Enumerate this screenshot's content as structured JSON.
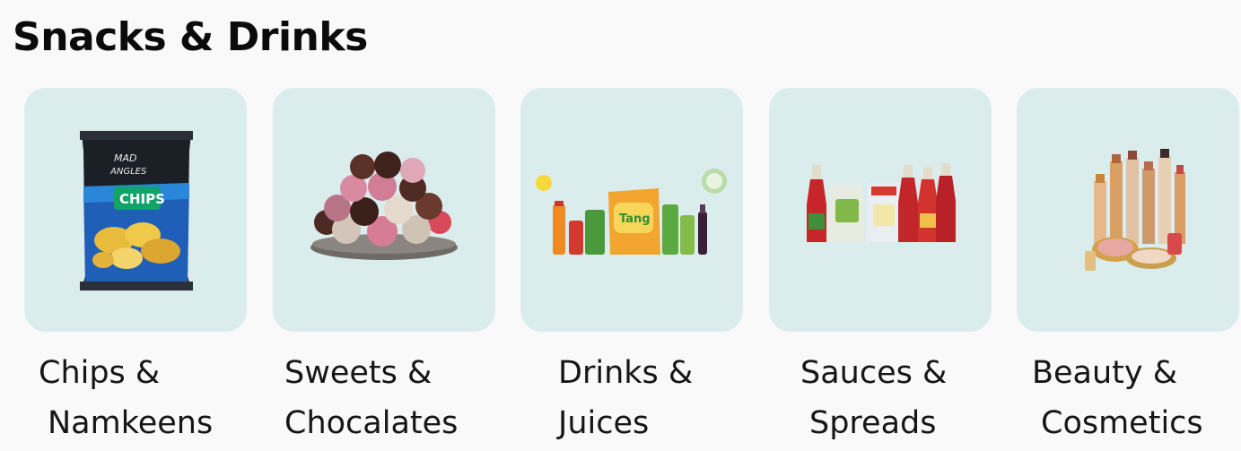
{
  "section": {
    "title": "Snacks & Drinks"
  },
  "categories": [
    {
      "line1": "Chips &",
      "line2": "Namkeens",
      "image": "chips-packet"
    },
    {
      "line1": "Sweets &",
      "line2": "Chocalates",
      "image": "chocolate-bonbons"
    },
    {
      "line1": "Drinks &",
      "line2": "Juices",
      "image": "juice-packs"
    },
    {
      "line1": "Sauces &",
      "line2": "Spreads",
      "image": "sauce-bottles"
    },
    {
      "line1": "Beauty &",
      "line2": "Cosmetics",
      "image": "lipsticks-cosmetics"
    }
  ],
  "colors": {
    "tile_background": "#dbeced",
    "page_background": "#f9f9f9"
  }
}
